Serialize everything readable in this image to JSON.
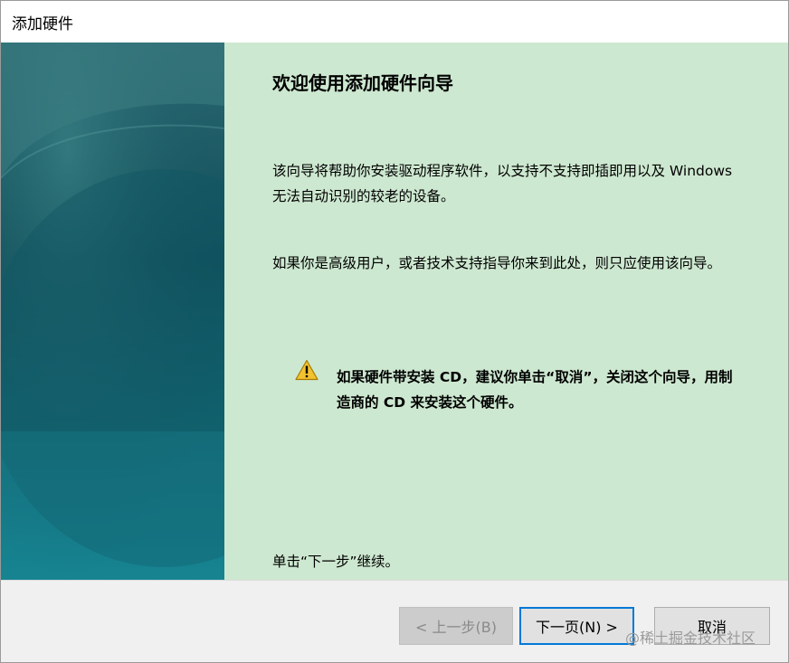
{
  "window": {
    "title": "添加硬件"
  },
  "wizard": {
    "heading": "欢迎使用添加硬件向导",
    "paragraph_1": "该向导将帮助你安装驱动程序软件，以支持不支持即插即用以及 Windows 无法自动识别的较老的设备。",
    "paragraph_2": "如果你是高级用户，或者技术支持指导你来到此处，则只应使用该向导。",
    "warning": {
      "icon": "warning-icon",
      "text": "如果硬件带安装 CD，建议你单击“取消”，关闭这个向导，用制造商的 CD 来安装这个硬件。"
    },
    "continue_hint": "单击“下一步”继续。"
  },
  "buttons": {
    "back": {
      "label": "< 上一步(B)",
      "enabled": false
    },
    "next": {
      "label": "下一页(N) >",
      "enabled": true,
      "focused": true
    },
    "cancel": {
      "label": "取消",
      "enabled": true
    }
  },
  "watermark": "@稀土掘金技术社区",
  "colors": {
    "content_background": "#cde8d0",
    "side_panel_top": "#2b6872",
    "side_panel_bottom": "#168693",
    "focus_border": "#0078d7",
    "warning_yellow": "#f2c230"
  }
}
